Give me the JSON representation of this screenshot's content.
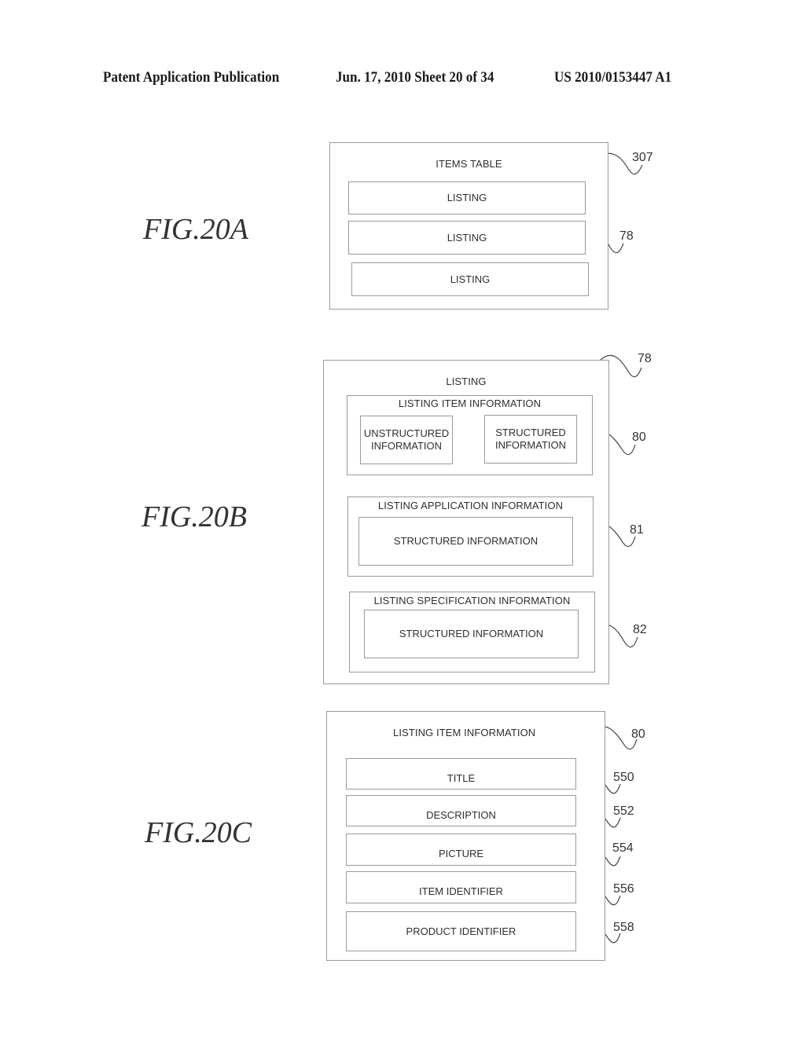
{
  "header": {
    "publication": "Patent Application Publication",
    "date_sheet": "Jun. 17, 2010  Sheet 20 of 34",
    "number": "US 2010/0153447 A1"
  },
  "fig20a": {
    "label": "FIG.20A",
    "title": "ITEMS TABLE",
    "ref": "307",
    "listings": [
      "LISTING",
      "LISTING",
      "LISTING"
    ],
    "listing_ref": "78"
  },
  "fig20b": {
    "label": "FIG.20B",
    "title": "LISTING",
    "ref": "78",
    "item_info": {
      "title": "LISTING ITEM INFORMATION",
      "ref": "80",
      "unstructured": "UNSTRUCTURED INFORMATION",
      "structured": "STRUCTURED INFORMATION"
    },
    "app_info": {
      "title": "LISTING APPLICATION INFORMATION",
      "ref": "81",
      "structured": "STRUCTURED INFORMATION"
    },
    "spec_info": {
      "title": "LISTING SPECIFICATION INFORMATION",
      "ref": "82",
      "structured": "STRUCTURED INFORMATION"
    }
  },
  "fig20c": {
    "label": "FIG.20C",
    "title": "LISTING ITEM INFORMATION",
    "ref": "80",
    "fields": [
      {
        "label": "TITLE",
        "ref": "550"
      },
      {
        "label": "DESCRIPTION",
        "ref": "552"
      },
      {
        "label": "PICTURE",
        "ref": "554"
      },
      {
        "label": "ITEM IDENTIFIER",
        "ref": "556"
      },
      {
        "label": "PRODUCT IDENTIFIER",
        "ref": "558"
      }
    ]
  }
}
